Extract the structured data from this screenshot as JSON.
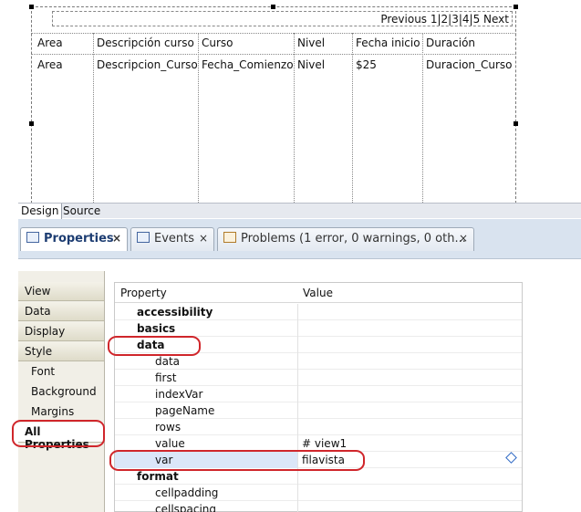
{
  "pager": {
    "text": "Previous 1|2|3|4|5 Next"
  },
  "table": {
    "headers": [
      "Area",
      "Descripción curso",
      "Curso",
      "Nivel",
      "Fecha inicio",
      "Duración"
    ],
    "row": [
      "Area",
      "Descripcion_Curso",
      "Fecha_Comienzo",
      "Nivel",
      "$25",
      "Duracion_Curso"
    ]
  },
  "editor_tabs": {
    "design": "Design",
    "source": "Source"
  },
  "views": {
    "properties": "Properties",
    "events": "Events",
    "problems": "Problems (1 error, 0 warnings, 0 oth...",
    "close": "×"
  },
  "categories": [
    {
      "label": "View"
    },
    {
      "label": "Data"
    },
    {
      "label": "Display"
    },
    {
      "label": "Style"
    },
    {
      "label": "Font"
    },
    {
      "label": "Background"
    },
    {
      "label": "Margins"
    },
    {
      "label": "All Properties"
    }
  ],
  "property_table": {
    "col_property": "Property",
    "col_value": "Value",
    "rows": [
      {
        "name": "accessibility",
        "value": ""
      },
      {
        "name": "basics",
        "value": ""
      },
      {
        "name": "data",
        "value": ""
      },
      {
        "name": "data",
        "value": ""
      },
      {
        "name": "first",
        "value": ""
      },
      {
        "name": "indexVar",
        "value": ""
      },
      {
        "name": "pageName",
        "value": ""
      },
      {
        "name": "rows",
        "value": ""
      },
      {
        "name": "value",
        "value": "# view1"
      },
      {
        "name": "var",
        "value": "filavista"
      },
      {
        "name": "format",
        "value": ""
      },
      {
        "name": "cellpadding",
        "value": ""
      },
      {
        "name": "cellspacing",
        "value": ""
      }
    ]
  },
  "colors": {
    "annotation": "#d0262b",
    "selected_row": "#dbe6f8",
    "tab_active_text": "#1d3d72"
  },
  "icons": {
    "properties_tab": "properties-icon",
    "events_tab": "events-icon",
    "problems_tab": "problems-icon",
    "edit_marker": "edit-diamond-icon"
  }
}
